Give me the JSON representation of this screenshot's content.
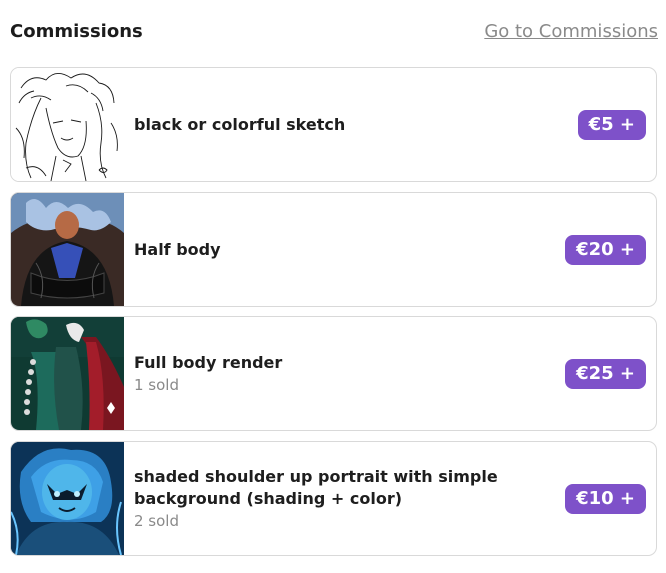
{
  "header": {
    "title": "Commissions",
    "link_label": "Go to Commissions"
  },
  "accent_color": "#7e51c9",
  "items": [
    {
      "name": "black or colorful sketch",
      "sold": "",
      "price": "€5 +",
      "thumb_icon": "sketch-thumbnail"
    },
    {
      "name": "Half body",
      "sold": "",
      "price": "€20 +",
      "thumb_icon": "half-body-thumbnail"
    },
    {
      "name": "Full body render",
      "sold": "1 sold",
      "price": "€25 +",
      "thumb_icon": "full-body-thumbnail"
    },
    {
      "name": "shaded shoulder up portrait with simple background (shading + color)",
      "sold": "2 sold",
      "price": "€10 +",
      "thumb_icon": "portrait-thumbnail"
    }
  ]
}
